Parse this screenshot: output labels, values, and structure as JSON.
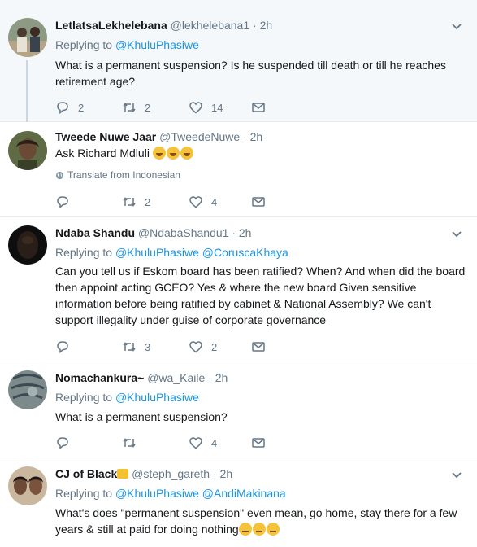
{
  "tweets": [
    {
      "name": "LetlatsaLekhelebana",
      "handle": "@lekhelebana1",
      "time": "2h",
      "replying_prefix": "Replying to",
      "mentions": [
        "@KhuluPhasiwe"
      ],
      "text": "What is a permanent suspension? Is he suspended till death or till he reaches retirement age?",
      "reply_count": "2",
      "retweet_count": "2",
      "like_count": "14"
    },
    {
      "name": "Tweede Nuwe Jaar",
      "handle": "@TweedeNuwe",
      "time": "2h",
      "text": "Ask Richard Mdluli",
      "translate_label": "Translate from Indonesian",
      "reply_count": "",
      "retweet_count": "2",
      "like_count": "4"
    },
    {
      "name": "Ndaba Shandu",
      "handle": "@NdabaShandu1",
      "time": "2h",
      "replying_prefix": "Replying to",
      "mentions": [
        "@KhuluPhasiwe",
        "@CoruscaKhaya"
      ],
      "text": "Can you tell us if Eskom board has been ratified? When? And when did the board then appoint acting GCEO? Yes & where the new board Given sensitive information before being ratified by cabinet & National Assembly? We can't support illegality under guise of corporate governance",
      "reply_count": "",
      "retweet_count": "3",
      "like_count": "2"
    },
    {
      "name": "Nomachankura~",
      "handle": "@wa_Kaile",
      "time": "2h",
      "replying_prefix": "Replying to",
      "mentions": [
        "@KhuluPhasiwe"
      ],
      "text": "What is a permanent suspension?",
      "reply_count": "",
      "retweet_count": "",
      "like_count": "4"
    },
    {
      "name": "CJ of Black",
      "handle": "@steph_gareth",
      "time": "2h",
      "replying_prefix": "Replying to",
      "mentions": [
        "@KhuluPhasiwe",
        "@AndiMakinana"
      ],
      "text": "What's does \"permanent suspension\" even mean, go home, stay there for a few years & still at paid for doing nothing"
    }
  ],
  "separator": "·",
  "icons": {
    "reply": "reply-icon",
    "retweet": "retweet-icon",
    "like": "heart-icon",
    "message": "envelope-icon",
    "more": "chevron-down-icon",
    "globe": "globe-icon"
  },
  "colors": {
    "link": "#1b95e0",
    "muted": "#657786",
    "text": "#14171a",
    "highlight_bg": "#f5f8fa",
    "divider": "#e6ecf0"
  }
}
